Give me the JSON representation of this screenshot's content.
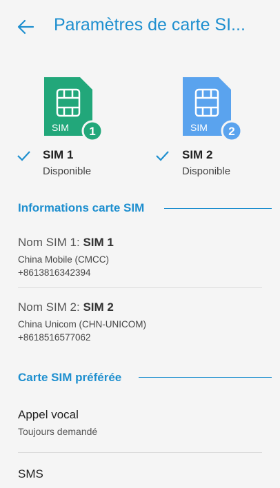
{
  "header": {
    "title": "Paramètres de carte SI..."
  },
  "sims": [
    {
      "name": "SIM 1",
      "status": "Disponible",
      "card_text": "SIM",
      "badge": "1",
      "color": "#22a77a",
      "checked": true
    },
    {
      "name": "SIM 2",
      "status": "Disponible",
      "card_text": "SIM",
      "badge": "2",
      "color": "#5aa3ee",
      "checked": true
    }
  ],
  "sections": {
    "info": {
      "title": "Informations carte SIM",
      "items": [
        {
          "label_prefix": "Nom SIM 1: ",
          "label_bold": "SIM 1",
          "carrier": "China Mobile (CMCC)",
          "number": "+8613816342394"
        },
        {
          "label_prefix": "Nom SIM 2: ",
          "label_bold": "SIM 2",
          "carrier": "China Unicom (CHN-UNICOM)",
          "number": "+8618516577062"
        }
      ]
    },
    "preferred": {
      "title": "Carte SIM préférée",
      "items": [
        {
          "title": "Appel vocal",
          "subtitle": "Toujours demandé"
        },
        {
          "title": "SMS"
        }
      ]
    }
  },
  "colors": {
    "accent": "#1e8fcf",
    "background": "#f5f5f5"
  }
}
